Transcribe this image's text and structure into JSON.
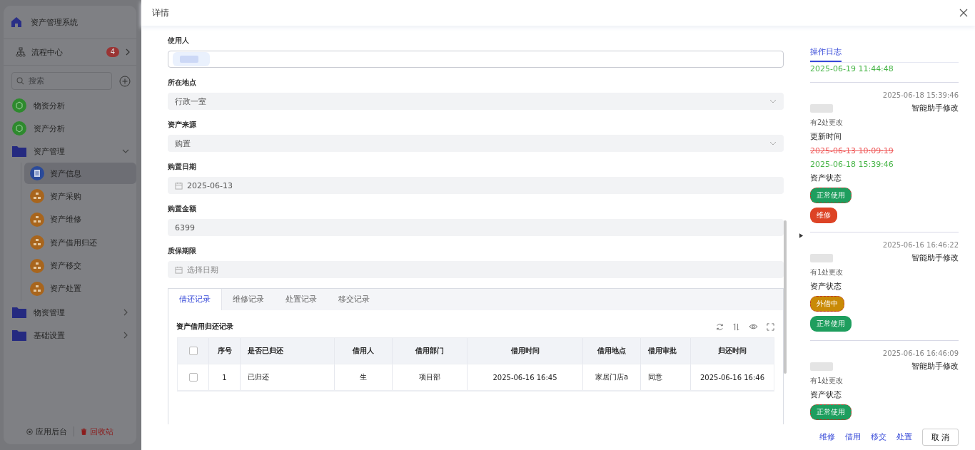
{
  "sidebar": {
    "app_title": "资产管理系统",
    "workflow": {
      "label": "流程中心",
      "badge": "4"
    },
    "search": {
      "placeholder": "搜索"
    },
    "menu": [
      {
        "label": "物资分析",
        "kind": "chart",
        "selected": false
      },
      {
        "label": "资产分析",
        "kind": "chart",
        "selected": false
      },
      {
        "label": "资产管理",
        "kind": "folder",
        "expanded": true,
        "selected": false,
        "children": [
          {
            "label": "资产信息",
            "kind": "doc",
            "selected": true
          },
          {
            "label": "资产采购",
            "kind": "org",
            "selected": false
          },
          {
            "label": "资产维修",
            "kind": "org",
            "selected": false
          },
          {
            "label": "资产借用归还",
            "kind": "org",
            "selected": false
          },
          {
            "label": "资产移交",
            "kind": "org",
            "selected": false
          },
          {
            "label": "资产处置",
            "kind": "org",
            "selected": false
          }
        ]
      },
      {
        "label": "物资管理",
        "kind": "folder",
        "expanded": false,
        "selected": false
      },
      {
        "label": "基础设置",
        "kind": "folder",
        "expanded": false,
        "selected": false
      }
    ],
    "footer": [
      {
        "label": "应用后台",
        "kind": "settings"
      },
      {
        "label": "回收站",
        "kind": "trash"
      }
    ]
  },
  "drawer": {
    "title": "详情",
    "fields": [
      {
        "label": "使用人",
        "kind": "user"
      },
      {
        "label": "所在地点",
        "kind": "select",
        "value": "行政一室"
      },
      {
        "label": "资产来源",
        "kind": "select",
        "value": "购置"
      },
      {
        "label": "购置日期",
        "kind": "date",
        "value": "2025-06-13"
      },
      {
        "label": "购置金额",
        "kind": "number",
        "value": "6399"
      },
      {
        "label": "质保期限",
        "kind": "date",
        "placeholder": "选择日期"
      }
    ],
    "tabs": [
      {
        "label": "借还记录",
        "selected": true
      },
      {
        "label": "维修记录",
        "selected": false
      },
      {
        "label": "处置记录",
        "selected": false
      },
      {
        "label": "移交记录",
        "selected": false
      }
    ],
    "table": {
      "title": "资产借用归还记录",
      "all_checked": false,
      "columns": [
        "序号",
        "是否已归还",
        "借用人",
        "借用部门",
        "借用时间",
        "借用地点",
        "借用审批",
        "归还时间"
      ],
      "rows": [
        {
          "checked": false,
          "cells": [
            "1",
            "已归还",
            "生",
            "项目部",
            "2025-06-16 16:45",
            "家居门店a",
            "同意",
            "2025-06-16 16:46"
          ]
        }
      ]
    },
    "log": {
      "tab": {
        "label": "操作日志",
        "selected": true
      },
      "entries": [
        {
          "changes": [
            {
              "kind": "text",
              "values": [
                {
                  "text": "2025-06-19 11:44:48",
                  "old": false
                }
              ]
            }
          ]
        },
        {
          "time": "2025-06-18 15:39:46",
          "action": "智能助手修改",
          "count": "有2处更改",
          "changes": [
            {
              "kind": "text",
              "field": "更新时间",
              "values": [
                {
                  "text": "2025-06-13 10:09:19",
                  "old": true
                },
                {
                  "text": "2025-06-18 15:39:46",
                  "old": false
                }
              ]
            },
            {
              "kind": "tag",
              "field": "资产状态",
              "values": [
                {
                  "text": "正常使用",
                  "old": true,
                  "color": "#1e9e5e"
                },
                {
                  "text": "维修",
                  "old": false,
                  "color": "#dd4325"
                }
              ]
            }
          ]
        },
        {
          "time": "2025-06-16 16:46:22",
          "action": "智能助手修改",
          "count": "有1处更改",
          "changes": [
            {
              "kind": "tag",
              "field": "资产状态",
              "values": [
                {
                  "text": "外借中",
                  "old": true,
                  "color": "#c98a06"
                },
                {
                  "text": "正常使用",
                  "old": false,
                  "color": "#1e9e5e"
                }
              ]
            }
          ]
        },
        {
          "time": "2025-06-16 16:46:09",
          "action": "智能助手修改",
          "count": "有1处更改",
          "changes": [
            {
              "kind": "tag",
              "field": "资产状态",
              "values": [
                {
                  "text": "正常使用",
                  "old": true,
                  "color": "#1e9e5e"
                }
              ]
            }
          ]
        }
      ]
    },
    "actions": [
      "维修",
      "借用",
      "移交",
      "处置"
    ],
    "cancel": "取 消"
  }
}
